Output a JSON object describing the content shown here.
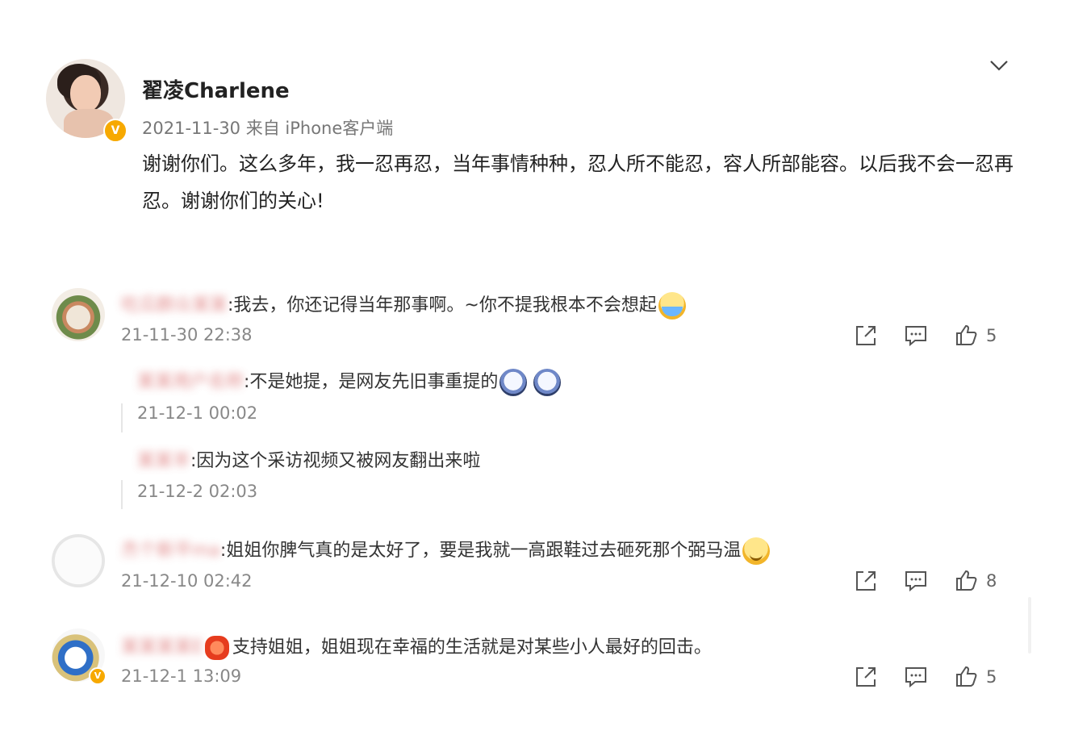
{
  "post": {
    "username": "翟凌Charlene",
    "meta": "2021-11-30  来自 iPhone客户端",
    "verified_badge": "V",
    "text": "谢谢你们。这么多年，我一忍再忍，当年事情种种，忍人所不能忍，容人所部能容。以后我不会一忍再忍。谢谢你们的关心!"
  },
  "comments": [
    {
      "blurred_name": "吃瓜群众某某",
      "text": ":我去，你还记得当年那事啊。~你不提我根本不会想起",
      "emoji": "crying-laugh-emoji",
      "time": "21-11-30 22:38",
      "likes": "5",
      "replies": [
        {
          "blurred_name": "某某用户名称",
          "text": ":不是她提，是网友先旧事重提的",
          "emoji": "doge-emoji",
          "time": "21-12-1 00:02"
        },
        {
          "blurred_name": "某某羊",
          "text": ":因为这个采访视频又被网友翻出来啦",
          "time": "21-12-2 02:03"
        }
      ]
    },
    {
      "blurred_name": "杰个新平ma",
      "text": ":姐姐你脾气真的是太好了，要是我就一高跟鞋过去砸死那个弼马温",
      "emoji": "smile-emoji",
      "time": "21-12-10 02:42",
      "likes": "8"
    },
    {
      "blurred_name": "某某某某E",
      "text": "支持姐姐，姐姐现在幸福的生活就是对某些小人最好的回击。",
      "emoji": "heart-emoji",
      "time": "21-12-1 13:09",
      "likes": "5"
    }
  ],
  "icons": {
    "more": "chevron-down-icon",
    "share": "share-icon",
    "comment": "comment-icon",
    "like": "thumbs-up-icon"
  },
  "colors": {
    "verified": "#f7a900",
    "text": "#222222",
    "meta": "#777777"
  }
}
